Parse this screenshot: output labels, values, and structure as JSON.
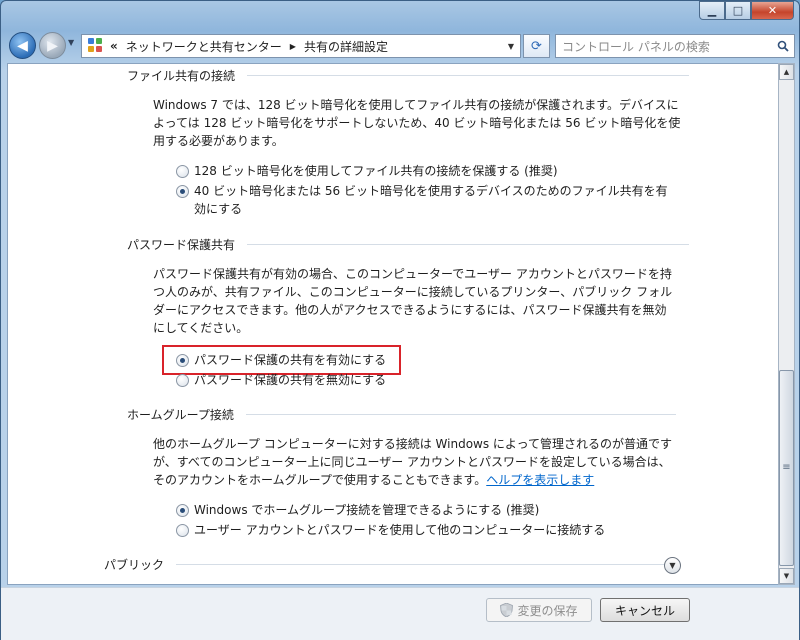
{
  "titlebar": {
    "min_glyph": "▁",
    "max_glyph": "□",
    "close_glyph": "✕"
  },
  "nav": {
    "back_glyph": "◀",
    "forward_glyph": "▶",
    "history_glyph": "▼",
    "address": {
      "chevron": "«",
      "segments": [
        "ネットワークと共有センター",
        "共有の詳細設定"
      ],
      "separator": "▶",
      "dropdown_glyph": "▼"
    },
    "refresh_glyph": "⟳",
    "search": {
      "placeholder": "コントロール パネルの検索"
    }
  },
  "sections": {
    "file_sharing": {
      "title": "ファイル共有の接続",
      "description": [
        "Windows 7 では、128 ビット暗号化を使用してファイル共有の接続が保護されます。デバイスに",
        "よっては 128 ビット暗号化をサポートしないため、40 ビット暗号化または 56 ビット暗号化を使",
        "用する必要があります。"
      ],
      "options": [
        {
          "lines": [
            "128 ビット暗号化を使用してファイル共有の接続を保護する (推奨)"
          ],
          "checked": false
        },
        {
          "lines": [
            "40 ビット暗号化または 56 ビット暗号化を使用するデバイスのためのファイル共有を有",
            "効にする"
          ],
          "checked": true
        }
      ]
    },
    "password_sharing": {
      "title": "パスワード保護共有",
      "description": [
        "パスワード保護共有が有効の場合、このコンピューターでユーザー アカウントとパスワードを持",
        "つ人のみが、共有ファイル、このコンピューターに接続しているプリンター、パブリック フォル",
        "ダーにアクセスできます。他の人がアクセスできるようにするには、パスワード保護共有を無効",
        "にしてください。"
      ],
      "options": [
        {
          "lines": [
            "パスワード保護の共有を有効にする"
          ],
          "checked": true
        },
        {
          "lines": [
            "パスワード保護の共有を無効にする"
          ],
          "checked": false
        }
      ]
    },
    "homegroup": {
      "title": "ホームグループ接続",
      "description": [
        "他のホームグループ コンピューターに対する接続は Windows によって管理されるのが普通です",
        "が、すべてのコンピューター上に同じユーザー アカウントとパスワードを設定している場合は、"
      ],
      "description_last": "そのアカウントをホームグループで使用することもできます。",
      "help_link": "ヘルプを表示します",
      "options": [
        {
          "lines": [
            "Windows でホームグループ接続を管理できるようにする (推奨)"
          ],
          "checked": true
        },
        {
          "lines": [
            "ユーザー アカウントとパスワードを使用して他のコンピューターに接続する"
          ],
          "checked": false
        }
      ]
    },
    "public": {
      "title": "パブリック",
      "expand_glyph": "▼"
    }
  },
  "scrollbar": {
    "up_glyph": "▲",
    "down_glyph": "▼",
    "grip": "≡"
  },
  "footer": {
    "save_label": "変更の保存",
    "cancel_label": "キャンセル"
  },
  "colors": {
    "highlight": "#d9232a",
    "link": "#0066cc",
    "window_frame": "#b9d2ea"
  }
}
